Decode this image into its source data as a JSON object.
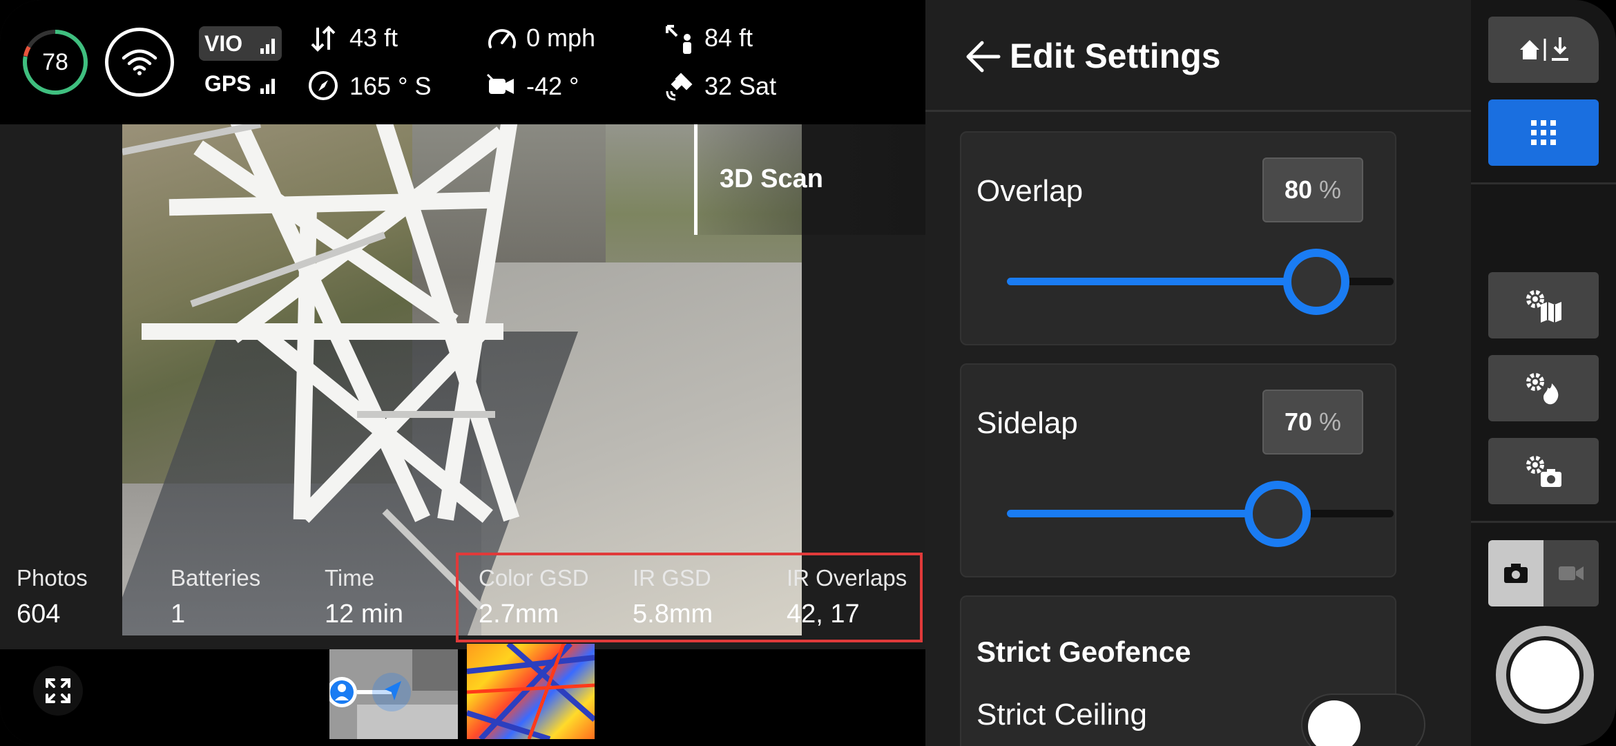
{
  "status": {
    "battery_percent": "78",
    "vio_label": "VIO",
    "gps_label": "GPS",
    "altitude": "43 ft",
    "heading": "165 ° S",
    "speed": "0 mph",
    "gimbal_pitch": "-42 °",
    "distance": "84 ft",
    "satellites": "32 Sat"
  },
  "camera_view": {
    "mode_label": "3D Scan"
  },
  "stats": [
    {
      "label": "Photos",
      "value": "604"
    },
    {
      "label": "Batteries",
      "value": "1"
    },
    {
      "label": "Time",
      "value": "12 min"
    },
    {
      "label": "Color GSD",
      "value": "2.7mm"
    },
    {
      "label": "IR GSD",
      "value": "5.8mm"
    },
    {
      "label": "IR Overlaps",
      "value": "42, 17"
    }
  ],
  "panel": {
    "title": "Edit Settings",
    "overlap": {
      "label": "Overlap",
      "value": "80",
      "unit": "%",
      "fraction": 0.8
    },
    "sidelap": {
      "label": "Sidelap",
      "value": "70",
      "unit": "%",
      "fraction": 0.7
    },
    "geofence_title": "Strict Geofence",
    "ceiling_label": "Strict Ceiling",
    "ceiling_enabled": false
  },
  "colors": {
    "accent": "#1a7cf3",
    "highlight": "#e03a3a",
    "battery_ring": "#3fbf7f"
  },
  "icons": {
    "home_return": "home-return-icon",
    "grid": "grid-icon",
    "map_settings": "map-settings-icon",
    "thermal_settings": "thermal-settings-icon",
    "camera_settings": "camera-settings-icon",
    "photo": "photo-camera-icon",
    "video": "video-camera-icon",
    "expand": "expand-icon"
  }
}
